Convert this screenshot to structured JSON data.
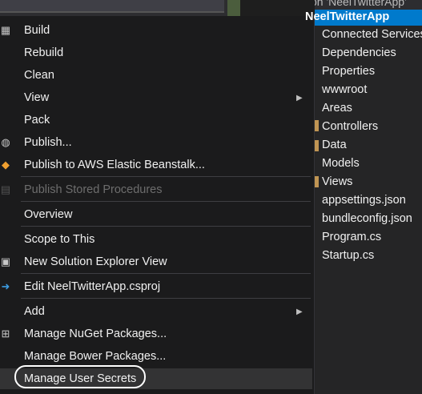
{
  "menu": {
    "items": [
      {
        "label": "Build",
        "icon": "build-icon"
      },
      {
        "label": "Rebuild"
      },
      {
        "label": "Clean"
      },
      {
        "label": "View",
        "submenu": true
      },
      {
        "label": "Pack"
      },
      {
        "label": "Publish...",
        "icon": "globe-icon"
      },
      {
        "label": "Publish to AWS Elastic Beanstalk...",
        "icon": "aws-icon"
      },
      {
        "label": "Publish Stored Procedures",
        "disabled": true,
        "icon": "database-icon"
      },
      {
        "label": "Overview"
      },
      {
        "label": "Scope to This"
      },
      {
        "label": "New Solution Explorer View",
        "icon": "new-view-icon"
      },
      {
        "label": "Edit NeelTwitterApp.csproj",
        "icon": "arrow-right-icon"
      },
      {
        "label": "Add",
        "submenu": true
      },
      {
        "label": "Manage NuGet Packages...",
        "icon": "nuget-icon"
      },
      {
        "label": "Manage Bower Packages..."
      },
      {
        "label": "Manage User Secrets",
        "highlighted": true
      }
    ]
  },
  "solution_explorer": {
    "solution_label": "Solution 'NeelTwitterApp'",
    "selected_project": "NeelTwitterApp",
    "items": [
      "Connected Services",
      "Dependencies",
      "Properties",
      "wwwroot",
      "Areas",
      "Controllers",
      "Data",
      "Models",
      "Views",
      "appsettings.json",
      "bundleconfig.json",
      "Program.cs",
      "Startup.cs"
    ]
  },
  "colors": {
    "menu_bg": "#1b1b1c",
    "selection_blue": "#007acc",
    "disabled_text": "#6d6d6d"
  }
}
